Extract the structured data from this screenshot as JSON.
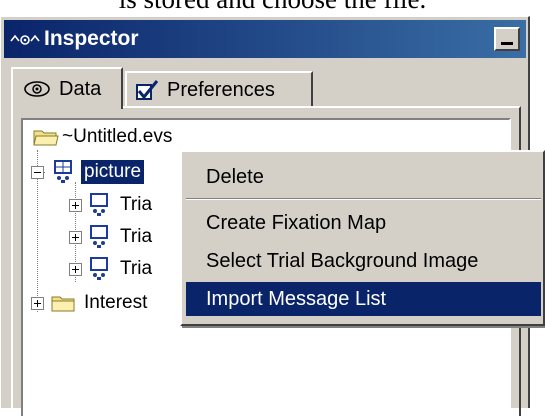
{
  "caption": "is stored and choose the file.",
  "window": {
    "title": "Inspector"
  },
  "tabs": [
    {
      "label": "Data",
      "icon": "eye-icon"
    },
    {
      "label": "Preferences",
      "icon": "checkbox-icon"
    }
  ],
  "tree": {
    "root": "~Untitled.evs",
    "selected": "picture",
    "trials": [
      "Tria",
      "Tria",
      "Tria"
    ],
    "interest": "Interest"
  },
  "context_menu": {
    "items": [
      "Delete",
      "Create Fixation Map",
      "Select Trial Background Image",
      "Import Message List"
    ],
    "highlighted": "Import Message List"
  },
  "colors": {
    "titlebar": "#0a246a",
    "selection": "#0a246a",
    "chrome": "#d4d0c8"
  }
}
